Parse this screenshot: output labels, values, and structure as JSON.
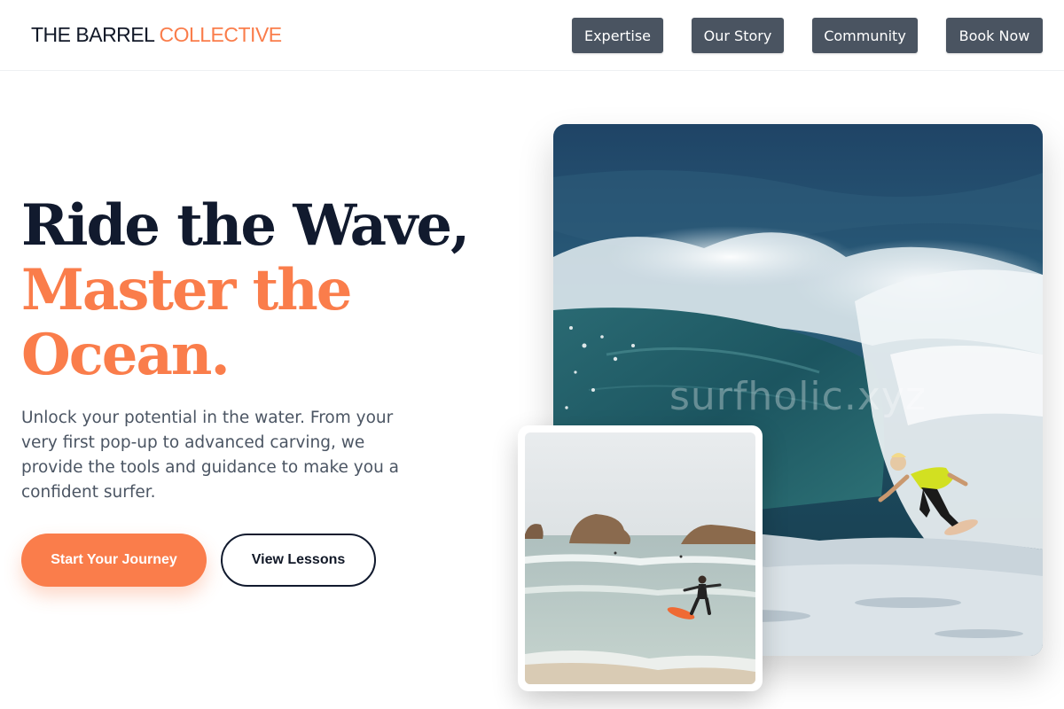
{
  "header": {
    "brand_primary": "THE BARREL",
    "brand_accent": "COLLECTIVE",
    "nav": [
      {
        "label": "Expertise"
      },
      {
        "label": "Our Story"
      },
      {
        "label": "Community"
      },
      {
        "label": "Book Now"
      }
    ]
  },
  "hero": {
    "headline_line1": "Ride the Wave,",
    "headline_line2": "Master the",
    "headline_line3": "Ocean.",
    "intro": "Unlock your potential in the water. From your very first pop-up to advanced carving, we provide the tools and guidance to make you a confident surfer.",
    "primary_cta": "Start Your Journey",
    "secondary_cta": "View Lessons"
  },
  "images": {
    "main_watermark": "surfholic.xyz"
  },
  "colors": {
    "accent": "#fa7d4b",
    "dark": "#111a2e",
    "nav_button": "#4a5461",
    "body_text": "#4b5563"
  }
}
